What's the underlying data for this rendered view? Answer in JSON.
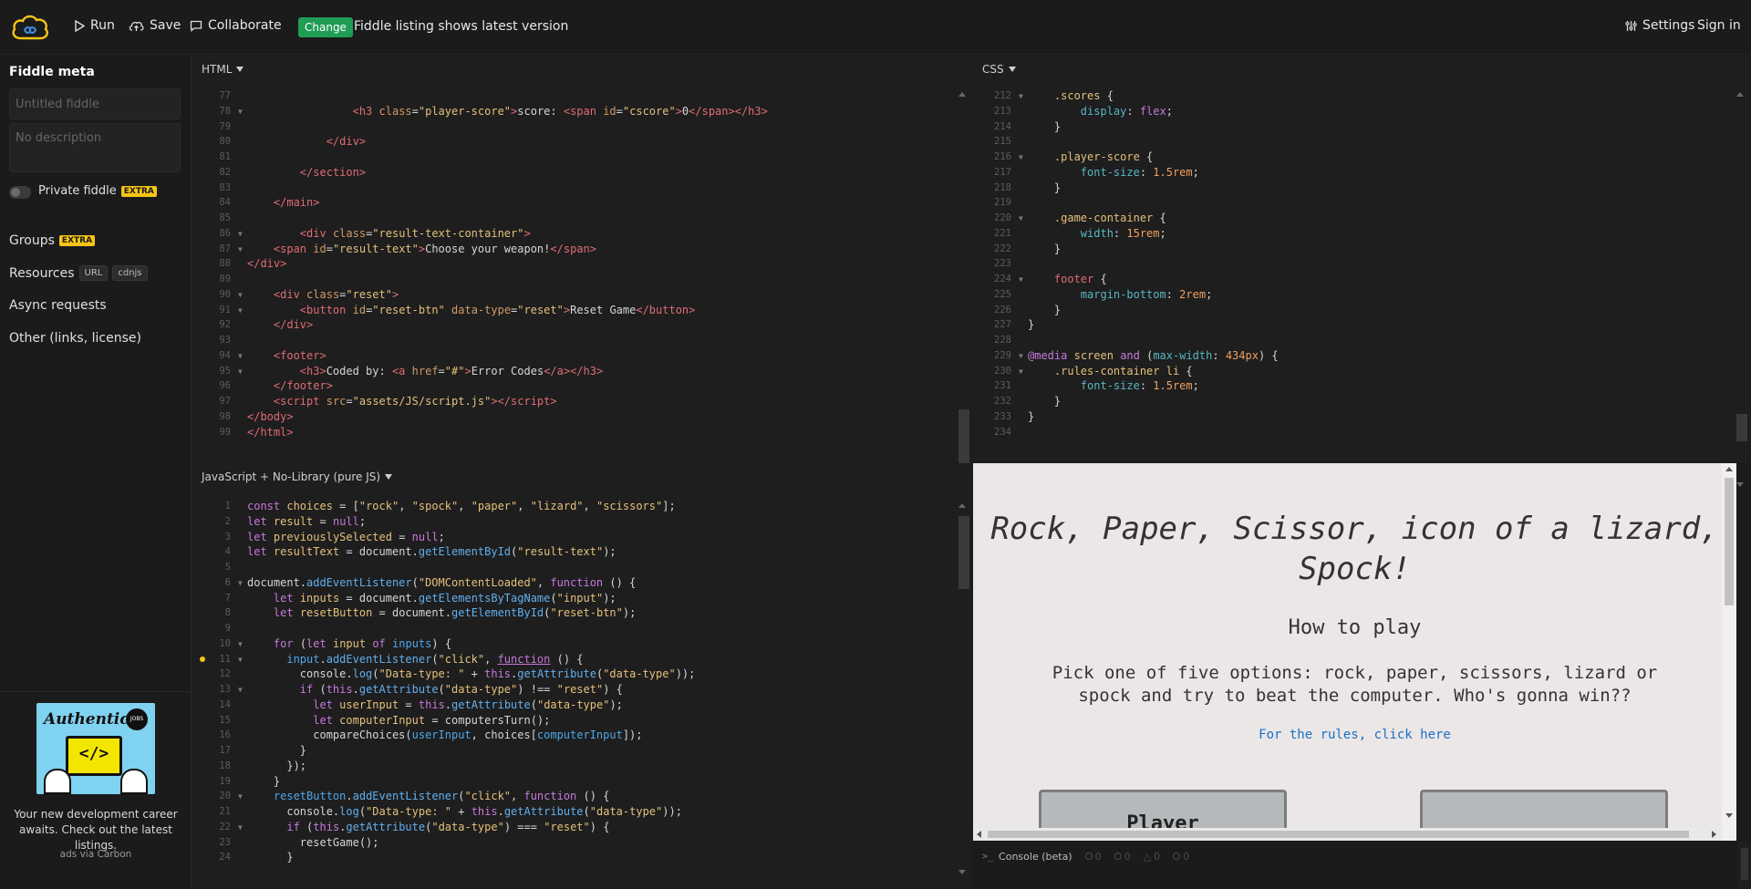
{
  "topbar": {
    "run_label": "Run",
    "save_label": "Save",
    "collaborate_label": "Collaborate",
    "change_badge": "Change",
    "listing_text": "Fiddle listing shows latest version",
    "settings_label": "Settings",
    "signin_label": "Sign in"
  },
  "sidebar": {
    "title": "Fiddle meta",
    "name_placeholder": "Untitled fiddle",
    "description_placeholder": "No description",
    "private_label": "Private fiddle",
    "extra_badge": "EXTRA",
    "groups_label": "Groups",
    "resources_label": "Resources",
    "url_chip": "URL",
    "cdnjs_chip": "cdnjs",
    "async_label": "Async requests",
    "other_label": "Other (links, license)",
    "ad_brand": "Authentic",
    "ad_jobs": "JOBS",
    "ad_text": "Your new development career awaits. Check out the latest listings.",
    "ad_via": "ads via Carbon"
  },
  "html_panel": {
    "title": "HTML",
    "lines": [
      {
        "n": "77",
        "html": ""
      },
      {
        "n": "78",
        "fold": true,
        "html": "                <span class='t-tag'>&lt;h3</span> <span class='t-attr'>class</span>=<span class='t-str'>\"player-score\"</span><span class='t-tag'>&gt;</span>score: <span class='t-tag'>&lt;span</span> <span class='t-attr'>id</span>=<span class='t-str'>\"cscore\"</span><span class='t-tag'>&gt;</span>0<span class='t-tag'>&lt;/span&gt;&lt;/h3&gt;</span>"
      },
      {
        "n": "79",
        "html": ""
      },
      {
        "n": "80",
        "html": "            <span class='t-tag'>&lt;/div&gt;</span>"
      },
      {
        "n": "81",
        "html": ""
      },
      {
        "n": "82",
        "html": "        <span class='t-tag'>&lt;/section&gt;</span>"
      },
      {
        "n": "83",
        "html": ""
      },
      {
        "n": "84",
        "html": "    <span class='t-tag'>&lt;/main&gt;</span>"
      },
      {
        "n": "85",
        "html": ""
      },
      {
        "n": "86",
        "fold": true,
        "html": "        <span class='t-tag'>&lt;div</span> <span class='t-attr'>class</span>=<span class='t-str'>\"result-text-container\"</span><span class='t-tag'>&gt;</span>"
      },
      {
        "n": "87",
        "fold": true,
        "html": "    <span class='t-tag'>&lt;span</span> <span class='t-attr'>id</span>=<span class='t-str'>\"result-text\"</span><span class='t-tag'>&gt;</span>Choose your weapon!<span class='t-tag'>&lt;/span&gt;</span>"
      },
      {
        "n": "88",
        "html": "<span class='t-tag'>&lt;/div&gt;</span>"
      },
      {
        "n": "89",
        "html": ""
      },
      {
        "n": "90",
        "fold": true,
        "html": "    <span class='t-tag'>&lt;div</span> <span class='t-attr'>class</span>=<span class='t-str'>\"reset\"</span><span class='t-tag'>&gt;</span>"
      },
      {
        "n": "91",
        "fold": true,
        "html": "        <span class='t-tag'>&lt;button</span> <span class='t-attr'>id</span>=<span class='t-str'>\"reset-btn\"</span> <span class='t-attr'>data-type</span>=<span class='t-str'>\"reset\"</span><span class='t-tag'>&gt;</span>Reset Game<span class='t-tag'>&lt;/button&gt;</span>"
      },
      {
        "n": "92",
        "html": "    <span class='t-tag'>&lt;/div&gt;</span>"
      },
      {
        "n": "93",
        "html": ""
      },
      {
        "n": "94",
        "fold": true,
        "html": "    <span class='t-tag'>&lt;footer&gt;</span>"
      },
      {
        "n": "95",
        "fold": true,
        "html": "        <span class='t-tag'>&lt;h3&gt;</span>Coded by: <span class='t-tag'>&lt;a</span> <span class='t-attr'>href</span>=<span class='t-str'>\"#\"</span><span class='t-tag'>&gt;</span>Error Codes<span class='t-tag'>&lt;/a&gt;&lt;/h3&gt;</span>"
      },
      {
        "n": "96",
        "html": "    <span class='t-tag'>&lt;/footer&gt;</span>"
      },
      {
        "n": "97",
        "html": "    <span class='t-tag'>&lt;script</span> <span class='t-attr'>src</span>=<span class='t-str'>\"assets/JS/script.js\"</span><span class='t-tag'>&gt;&lt;/script&gt;</span>"
      },
      {
        "n": "98",
        "html": "<span class='t-tag'>&lt;/body&gt;</span>"
      },
      {
        "n": "99",
        "html": "<span class='t-tag'>&lt;/html&gt;</span>"
      }
    ]
  },
  "css_panel": {
    "title": "CSS",
    "lines": [
      {
        "n": "212",
        "fold": true,
        "html": "    <span class='t-sel'>.scores</span> {"
      },
      {
        "n": "213",
        "html": "        <span class='t-prop'>display</span>: <span class='t-kw'>flex</span>;"
      },
      {
        "n": "214",
        "html": "    }"
      },
      {
        "n": "215",
        "html": ""
      },
      {
        "n": "216",
        "fold": true,
        "html": "    <span class='t-sel'>.player-score</span> {"
      },
      {
        "n": "217",
        "html": "        <span class='t-prop'>font-size</span>: <span class='t-num'>1.5rem</span>;"
      },
      {
        "n": "218",
        "html": "    }"
      },
      {
        "n": "219",
        "html": ""
      },
      {
        "n": "220",
        "fold": true,
        "html": "    <span class='t-sel'>.game-container</span> {"
      },
      {
        "n": "221",
        "html": "        <span class='t-prop'>width</span>: <span class='t-num'>15rem</span>;"
      },
      {
        "n": "222",
        "html": "    }"
      },
      {
        "n": "223",
        "html": ""
      },
      {
        "n": "224",
        "fold": true,
        "html": "    <span class='t-tag'>footer</span> {"
      },
      {
        "n": "225",
        "html": "        <span class='t-prop'>margin-bottom</span>: <span class='t-num'>2rem</span>;"
      },
      {
        "n": "226",
        "html": "    }"
      },
      {
        "n": "227",
        "html": "}"
      },
      {
        "n": "228",
        "html": ""
      },
      {
        "n": "229",
        "fold": true,
        "html": "<span class='t-kw'>@media</span> <span class='t-sel'>screen</span> <span class='t-kw'>and</span> (<span class='t-prop'>max-width</span>: <span class='t-num'>434px</span>) {"
      },
      {
        "n": "230",
        "fold": true,
        "html": "    <span class='t-sel'>.rules-container li</span> {"
      },
      {
        "n": "231",
        "html": "        <span class='t-prop'>font-size</span>: <span class='t-num'>1.5rem</span>;"
      },
      {
        "n": "232",
        "html": "    }"
      },
      {
        "n": "233",
        "html": "}"
      },
      {
        "n": "234",
        "html": ""
      }
    ]
  },
  "js_panel": {
    "title": "JavaScript + No-Library (pure JS)",
    "lines": [
      {
        "n": "1",
        "html": "<span class='t-kw'>const</span> <span class='t-var'>choices</span> = [<span class='t-str'>\"rock\"</span>, <span class='t-str'>\"spock\"</span>, <span class='t-str'>\"paper\"</span>, <span class='t-str'>\"lizard\"</span>, <span class='t-str'>\"scissors\"</span>];"
      },
      {
        "n": "2",
        "html": "<span class='t-kw'>let</span> <span class='t-var'>result</span> = <span class='t-kw'>null</span>;"
      },
      {
        "n": "3",
        "html": "<span class='t-kw'>let</span> <span class='t-var'>previouslySelected</span> = <span class='t-kw'>null</span>;"
      },
      {
        "n": "4",
        "html": "<span class='t-kw'>let</span> <span class='t-var'>resultText</span> = document.<span class='t-fn'>getElementById</span>(<span class='t-str'>\"result-text\"</span>);"
      },
      {
        "n": "5",
        "html": ""
      },
      {
        "n": "6",
        "fold": true,
        "html": "document.<span class='t-fn'>addEventListener</span>(<span class='t-str'>\"DOMContentLoaded\"</span>, <span class='t-kw'>function</span> () {"
      },
      {
        "n": "7",
        "html": "    <span class='t-kw'>let</span> <span class='t-var'>inputs</span> = document.<span class='t-fn'>getElementsByTagName</span>(<span class='t-str'>\"input\"</span>);"
      },
      {
        "n": "8",
        "html": "    <span class='t-kw'>let</span> <span class='t-var'>resetButton</span> = document.<span class='t-fn'>getElementById</span>(<span class='t-str'>\"reset-btn\"</span>);"
      },
      {
        "n": "9",
        "html": ""
      },
      {
        "n": "10",
        "fold": true,
        "html": "    <span class='t-kw'>for</span> (<span class='t-kw'>let</span> <span class='t-var'>input</span> <span class='t-kw'>of</span> <span class='t-blue'>inputs</span>) {"
      },
      {
        "n": "11",
        "fold": true,
        "marker": true,
        "html": "      <span class='t-blue'>input</span>.<span class='t-fn'>addEventListener</span>(<span class='t-str'>\"click\"</span>, <span class='t-kw' style='text-decoration:underline'>function</span> () {"
      },
      {
        "n": "12",
        "html": "        console.<span class='t-fn'>log</span>(<span class='t-str'>\"Data-type: \"</span> + <span class='t-kw'>this</span>.<span class='t-fn'>getAttribute</span>(<span class='t-str'>\"data-type\"</span>));"
      },
      {
        "n": "13",
        "fold": true,
        "html": "        <span class='t-kw'>if</span> (<span class='t-kw'>this</span>.<span class='t-fn'>getAttribute</span>(<span class='t-str'>\"data-type\"</span>) !== <span class='t-str'>\"reset\"</span>) {"
      },
      {
        "n": "14",
        "html": "          <span class='t-kw'>let</span> <span class='t-var'>userInput</span> = <span class='t-kw'>this</span>.<span class='t-fn'>getAttribute</span>(<span class='t-str'>\"data-type\"</span>);"
      },
      {
        "n": "15",
        "html": "          <span class='t-kw'>let</span> <span class='t-var'>computerInput</span> = computersTurn();"
      },
      {
        "n": "16",
        "html": "          compareChoices(<span class='t-blue'>userInput</span>, choices[<span class='t-blue'>computerInput</span>]);"
      },
      {
        "n": "17",
        "html": "        }"
      },
      {
        "n": "18",
        "html": "      });"
      },
      {
        "n": "19",
        "html": "    }"
      },
      {
        "n": "20",
        "fold": true,
        "html": "    <span class='t-blue'>resetButton</span>.<span class='t-fn'>addEventListener</span>(<span class='t-str'>\"click\"</span>, <span class='t-kw'>function</span> () {"
      },
      {
        "n": "21",
        "html": "      console.<span class='t-fn'>log</span>(<span class='t-str'>\"Data-type: \"</span> + <span class='t-kw'>this</span>.<span class='t-fn'>getAttribute</span>(<span class='t-str'>\"data-type\"</span>));"
      },
      {
        "n": "22",
        "fold": true,
        "html": "      <span class='t-kw'>if</span> (<span class='t-kw'>this</span>.<span class='t-fn'>getAttribute</span>(<span class='t-str'>\"data-type\"</span>) === <span class='t-str'>\"reset\"</span>) {"
      },
      {
        "n": "23",
        "html": "        resetGame();"
      },
      {
        "n": "24",
        "html": "      }"
      }
    ]
  },
  "result": {
    "title": "Rock, Paper, Scissor, icon of a lizard, Spock!",
    "subtitle": "How to play",
    "description": "Pick one of five options: rock, paper, scissors, lizard or spock and try to beat the computer. Who's gonna win??",
    "rules_link": "For the rules, click here",
    "player_box": "Player"
  },
  "console": {
    "label": "Console (beta)",
    "counts": [
      "0",
      "0",
      "0",
      "0"
    ]
  }
}
